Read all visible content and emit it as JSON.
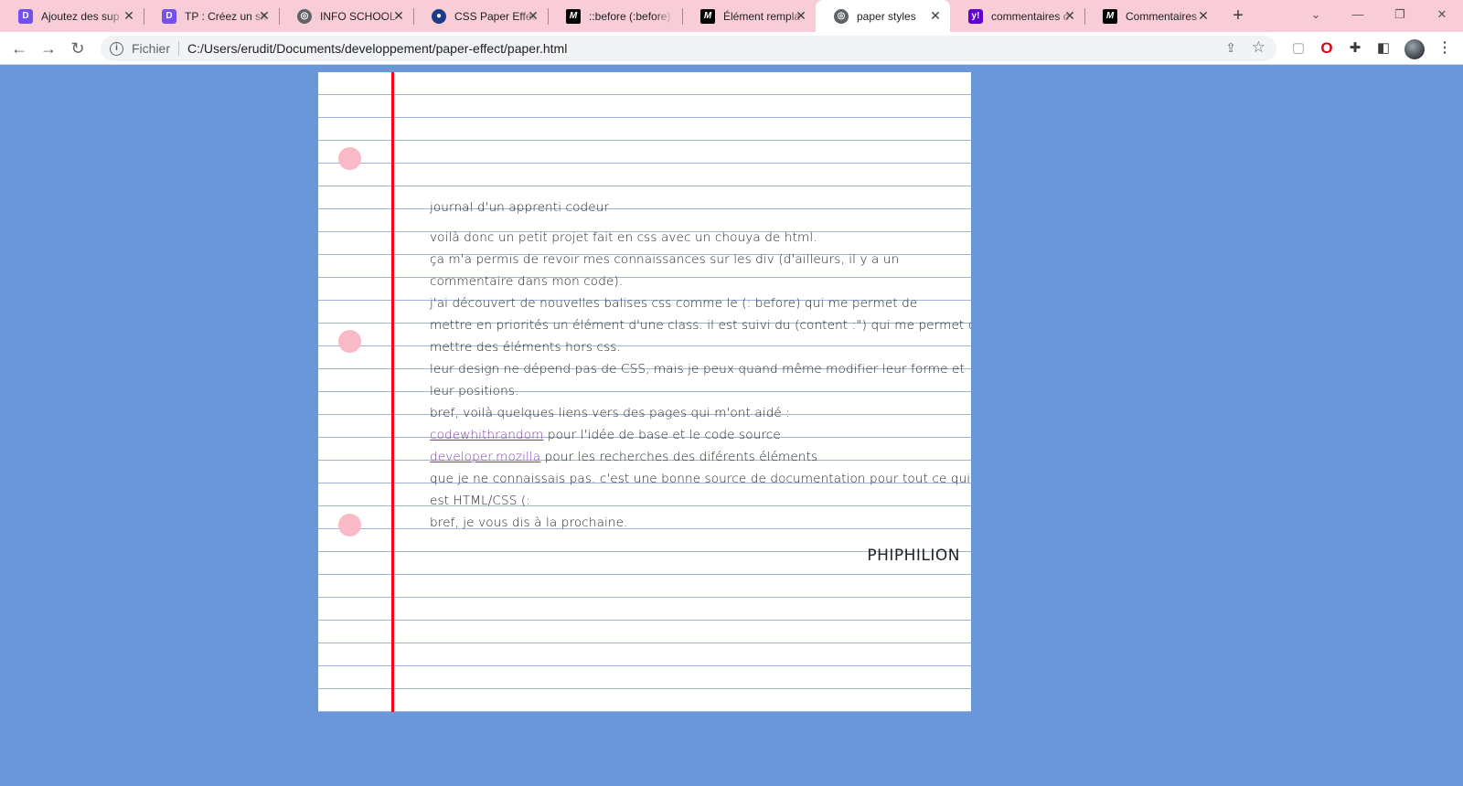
{
  "browser": {
    "tabs": [
      {
        "title": "Ajoutez des sup",
        "favicon": "openclassrooms-icon",
        "active": false
      },
      {
        "title": "TP : Créez un site",
        "favicon": "openclassrooms-icon",
        "active": false
      },
      {
        "title": "INFO SCHOOL",
        "favicon": "globe-icon",
        "active": false
      },
      {
        "title": "CSS Paper Effect",
        "favicon": "css-paper-icon",
        "active": false
      },
      {
        "title": "::before (:before)",
        "favicon": "mdn-icon",
        "active": false
      },
      {
        "title": "Élément rempla",
        "favicon": "mdn-icon",
        "active": false
      },
      {
        "title": "paper styles",
        "favicon": "globe-icon",
        "active": true
      },
      {
        "title": "commentaires c",
        "favicon": "yahoo-icon",
        "active": false
      },
      {
        "title": "Commentaires",
        "favicon": "mdn-icon",
        "active": false
      }
    ],
    "new_tab_icon": "plus-icon",
    "address": {
      "scheme_label": "Fichier",
      "url": "C:/Users/erudit/Documents/developpement/paper-effect/paper.html"
    }
  },
  "paper": {
    "title": "journal d'un apprenti codeur",
    "lines": [
      {
        "text": "voilà donc un petit projet fait en css avec un chouya de html."
      },
      {
        "text": "ça m'a permis de revoir mes connaissances sur les div (d'ailleurs, il y a un"
      },
      {
        "text": "commentaire dans mon code)."
      },
      {
        "text": "j'ai découvert de nouvelles balises css comme le (: before) qui me permet de"
      },
      {
        "text": "mettre en priorités un élément d'une class. il est suivi du (content :\") qui me permet de"
      },
      {
        "text": "mettre des éléments hors css."
      },
      {
        "text": "leur design ne dépend pas de CSS, mais je peux quand même modifier leur forme et"
      },
      {
        "text": "leur positions."
      },
      {
        "text": "bref, voilà quelques liens vers des pages qui m'ont aidé :"
      },
      {
        "link": "codewhithrandom",
        "text": " pour l'idée de base et le code source"
      },
      {
        "link": "developer.mozilla",
        "text": " pour les recherches des diférents éléments"
      },
      {
        "text": "que je ne connaissais pas. c'est une bonne source de documentation pour tout ce qui"
      },
      {
        "text": "est HTML/CSS (:"
      },
      {
        "text": "bref, je vous dis à la prochaine."
      }
    ],
    "signature": "PHIPHILION"
  },
  "colors": {
    "page_background": "#6a96da",
    "margin_line": "#ff0014",
    "rule_line": "#9db4d6",
    "hole": "#f9b9c6",
    "tab_strip": "#f9cdd7"
  }
}
